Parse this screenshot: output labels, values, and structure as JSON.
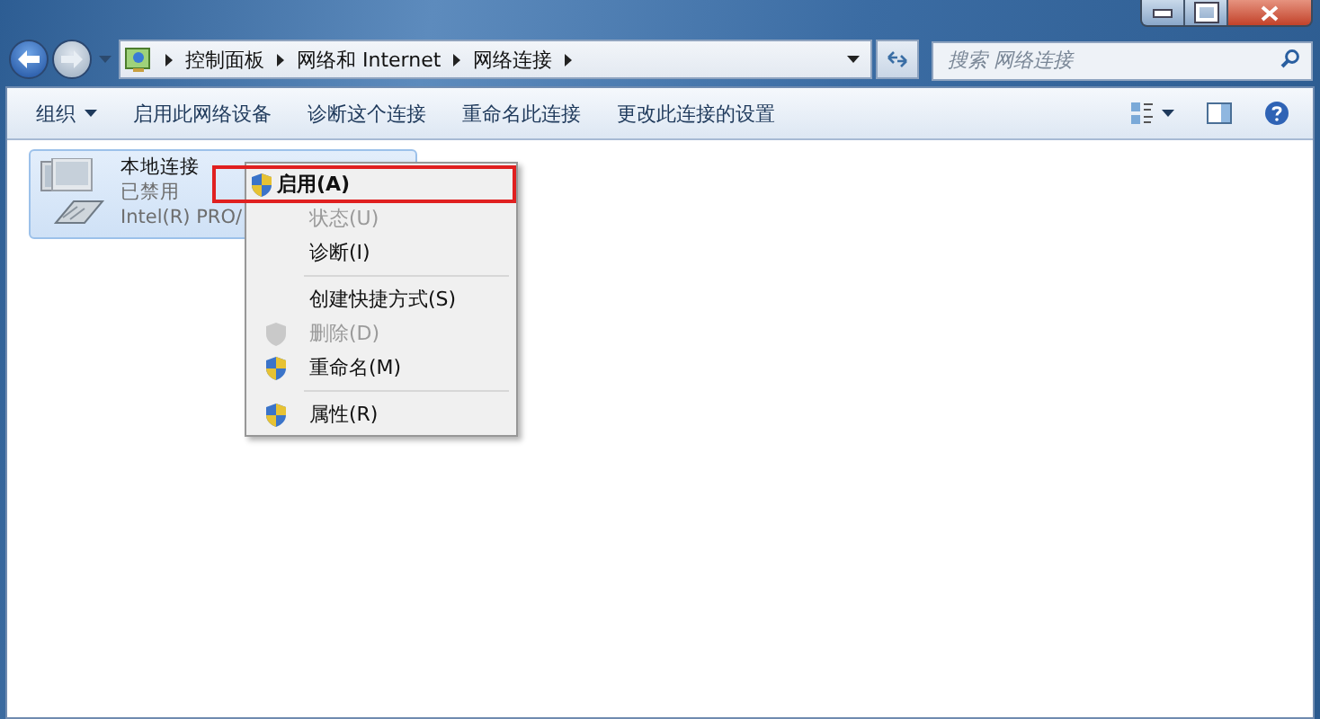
{
  "address_bar": {
    "breadcrumb": [
      "控制面板",
      "网络和 Internet",
      "网络连接"
    ]
  },
  "search": {
    "placeholder": "搜索 网络连接"
  },
  "toolbar": {
    "items": [
      {
        "label": "组织",
        "dropdown": true
      },
      {
        "label": "启用此网络设备",
        "dropdown": false
      },
      {
        "label": "诊断这个连接",
        "dropdown": false
      },
      {
        "label": "重命名此连接",
        "dropdown": false
      },
      {
        "label": "更改此连接的设置",
        "dropdown": false
      }
    ]
  },
  "connections": [
    {
      "name": "本地连接",
      "status": "已禁用",
      "adapter": "Intel(R) PRO/",
      "selected": true
    }
  ],
  "context_menu": {
    "items": [
      {
        "kind": "item",
        "label": "启用(A)",
        "shield": true,
        "disabled": false,
        "default": true,
        "highlighted": true
      },
      {
        "kind": "item",
        "label": "状态(U)",
        "shield": false,
        "disabled": true,
        "default": false,
        "highlighted": false
      },
      {
        "kind": "item",
        "label": "诊断(I)",
        "shield": false,
        "disabled": false,
        "default": false,
        "highlighted": false
      },
      {
        "kind": "separator"
      },
      {
        "kind": "item",
        "label": "创建快捷方式(S)",
        "shield": false,
        "disabled": false,
        "default": false,
        "highlighted": false
      },
      {
        "kind": "item",
        "label": "删除(D)",
        "shield": true,
        "disabled": true,
        "default": false,
        "highlighted": false
      },
      {
        "kind": "item",
        "label": "重命名(M)",
        "shield": true,
        "disabled": false,
        "default": false,
        "highlighted": false
      },
      {
        "kind": "separator"
      },
      {
        "kind": "item",
        "label": "属性(R)",
        "shield": true,
        "disabled": false,
        "default": false,
        "highlighted": false
      }
    ]
  }
}
